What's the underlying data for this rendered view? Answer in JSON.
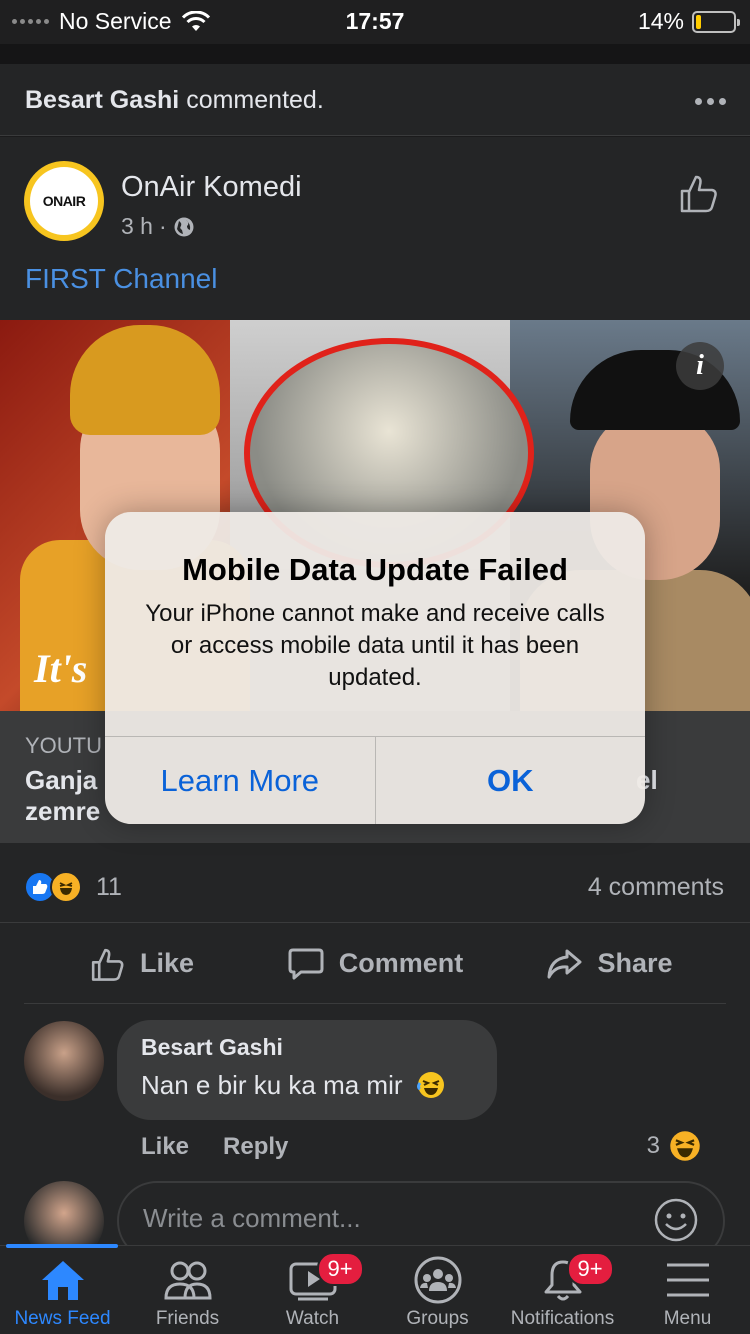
{
  "status_bar": {
    "carrier": "No Service",
    "time": "17:57",
    "battery": "14%",
    "battery_level": 0.14
  },
  "notice": {
    "author": "Besart Gashi",
    "action": "commented."
  },
  "post": {
    "page_name": "OnAir Komedi",
    "avatar_text": "ONAIR",
    "time": "3 h",
    "separator": "·",
    "link_text": "FIRST Channel",
    "thumbnail_caption": "It's",
    "info_label": "i",
    "preview_source": "YOUTU",
    "preview_title_left": "Ganja",
    "preview_title_left2": "zemre",
    "preview_title_right": "el",
    "reaction_count": "11",
    "comments_count": "4 comments",
    "actions": {
      "like": "Like",
      "comment": "Comment",
      "share": "Share"
    }
  },
  "comment": {
    "author": "Besart Gashi",
    "text": "Nan e bir ku ka ma mir",
    "like": "Like",
    "reply": "Reply",
    "reaction_count": "3"
  },
  "composer": {
    "placeholder": "Write a comment..."
  },
  "alert": {
    "title": "Mobile Data Update Failed",
    "message": "Your iPhone cannot make and receive calls or access mobile data until it has been updated.",
    "learn_more": "Learn More",
    "ok": "OK"
  },
  "tabbar": {
    "tabs": [
      {
        "label": "News Feed",
        "icon": "home-icon",
        "active": true
      },
      {
        "label": "Friends",
        "icon": "friends-icon"
      },
      {
        "label": "Watch",
        "icon": "watch-icon",
        "badge": "9+"
      },
      {
        "label": "Groups",
        "icon": "groups-icon"
      },
      {
        "label": "Notifications",
        "icon": "bell-icon",
        "badge": "9+"
      },
      {
        "label": "Menu",
        "icon": "menu-icon"
      }
    ]
  },
  "colors": {
    "accent": "#2d88ff",
    "link": "#4a90e2",
    "badge": "#e41e3f",
    "alert_button": "#0a62d8"
  }
}
